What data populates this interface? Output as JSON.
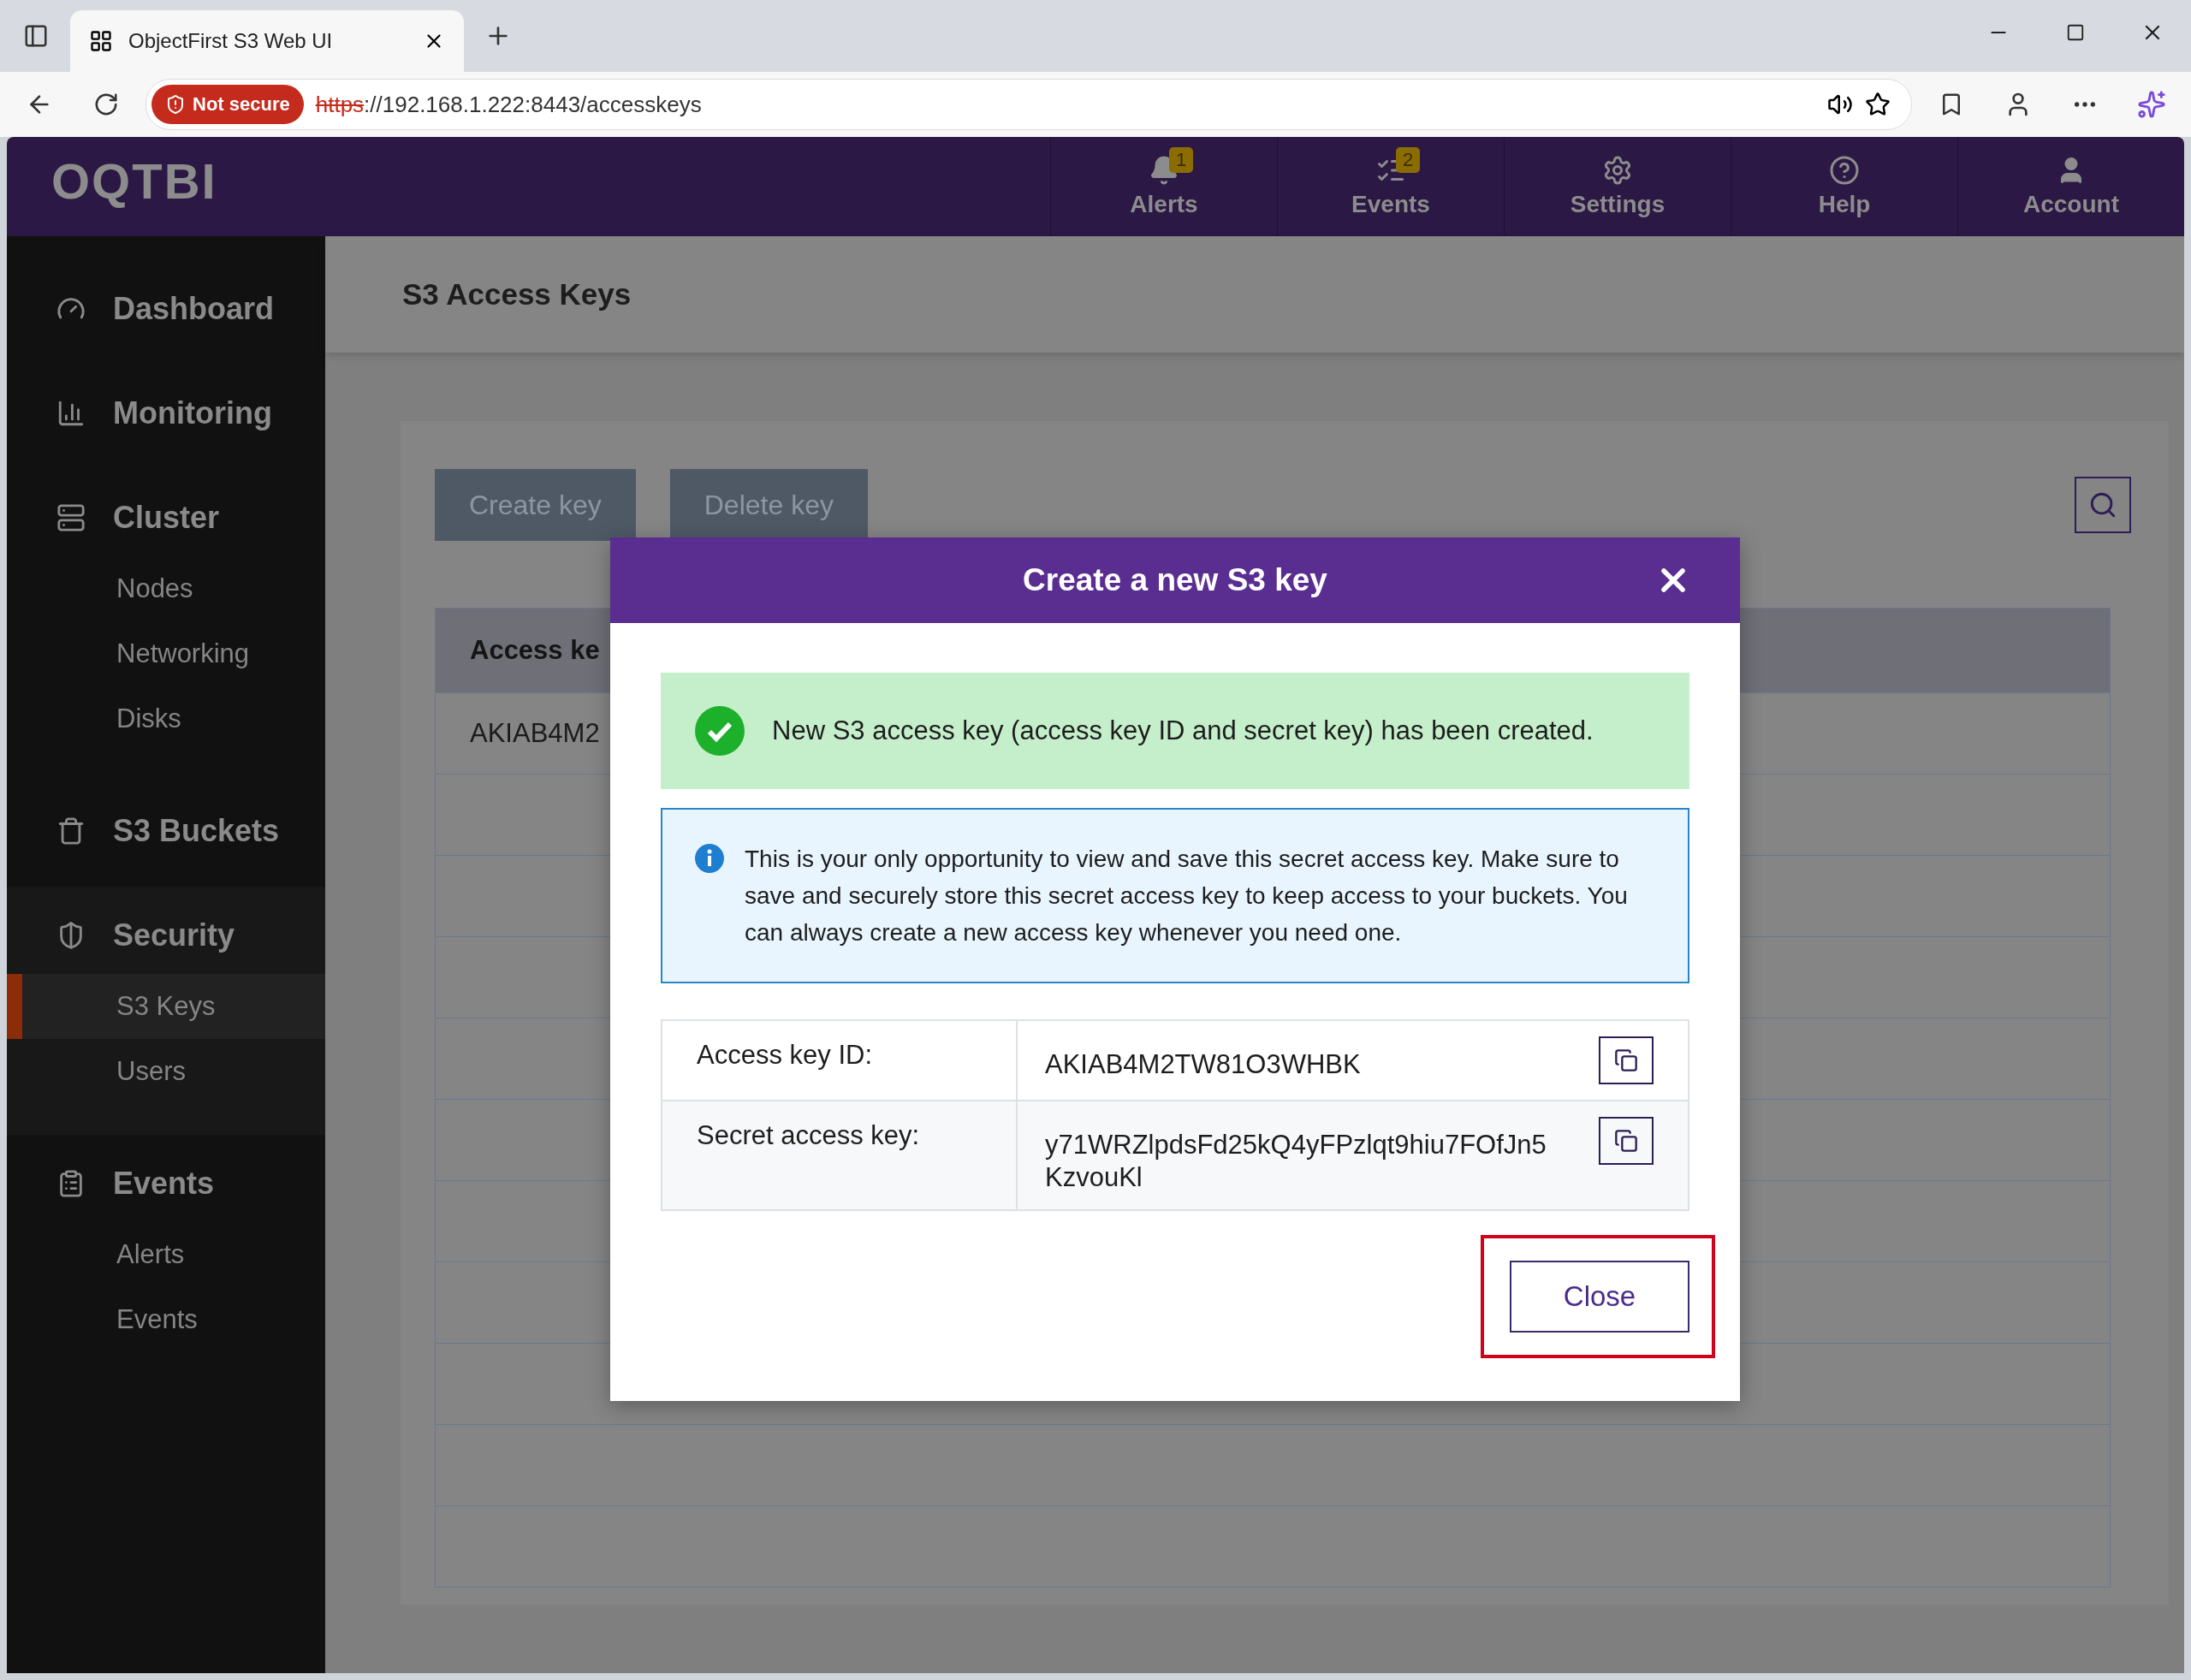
{
  "browser": {
    "tab_title": "ObjectFirst S3 Web UI",
    "security_label": "Not secure",
    "url_scheme": "https",
    "url_rest": "://192.168.1.222:8443/accesskeys"
  },
  "app": {
    "logo": "OQTBI",
    "nav": [
      {
        "kind": "alerts",
        "label": "Alerts",
        "badge": "1"
      },
      {
        "kind": "events",
        "label": "Events",
        "badge": "2"
      },
      {
        "kind": "settings",
        "label": "Settings"
      },
      {
        "kind": "help",
        "label": "Help"
      },
      {
        "kind": "account",
        "label": "Account"
      }
    ],
    "sidebar": [
      {
        "kind": "dashboard",
        "label": "Dashboard"
      },
      {
        "kind": "monitoring",
        "label": "Monitoring"
      },
      {
        "kind": "cluster",
        "label": "Cluster",
        "children": [
          {
            "label": "Nodes",
            "selected": false
          },
          {
            "label": "Networking",
            "selected": false
          },
          {
            "label": "Disks",
            "selected": false
          }
        ]
      },
      {
        "kind": "buckets",
        "label": "S3 Buckets"
      },
      {
        "kind": "security",
        "label": "Security",
        "children": [
          {
            "label": "S3 Keys",
            "selected": true
          },
          {
            "label": "Users",
            "selected": false
          }
        ]
      },
      {
        "kind": "events",
        "label": "Events",
        "children": [
          {
            "label": "Alerts",
            "selected": false
          },
          {
            "label": "Events",
            "selected": false
          }
        ]
      }
    ],
    "page_title": "S3 Access Keys",
    "toolbar": [
      "Create key",
      "Delete key"
    ],
    "table": {
      "columns": [
        "Access ke"
      ],
      "rows": [
        [
          "AKIAB4M2"
        ]
      ]
    }
  },
  "dialog": {
    "title": "Create a new S3 key",
    "success": "New S3 access key (access key ID and secret key) has been created.",
    "info": "This is your only opportunity to view and save this secret access key. Make sure to save and securely store this secret access key to keep access to your buckets. You can always create a new access key whenever you need one.",
    "fields": [
      {
        "label": "Access key ID:",
        "value": "AKIAB4M2TW81O3WHBK"
      },
      {
        "label": "Secret access key:",
        "value": "y71WRZlpdsFd25kQ4yFPzlqt9hiu7FOfJn5 KzvouKl"
      }
    ],
    "close_button": "Close",
    "close_highlighted": true
  }
}
